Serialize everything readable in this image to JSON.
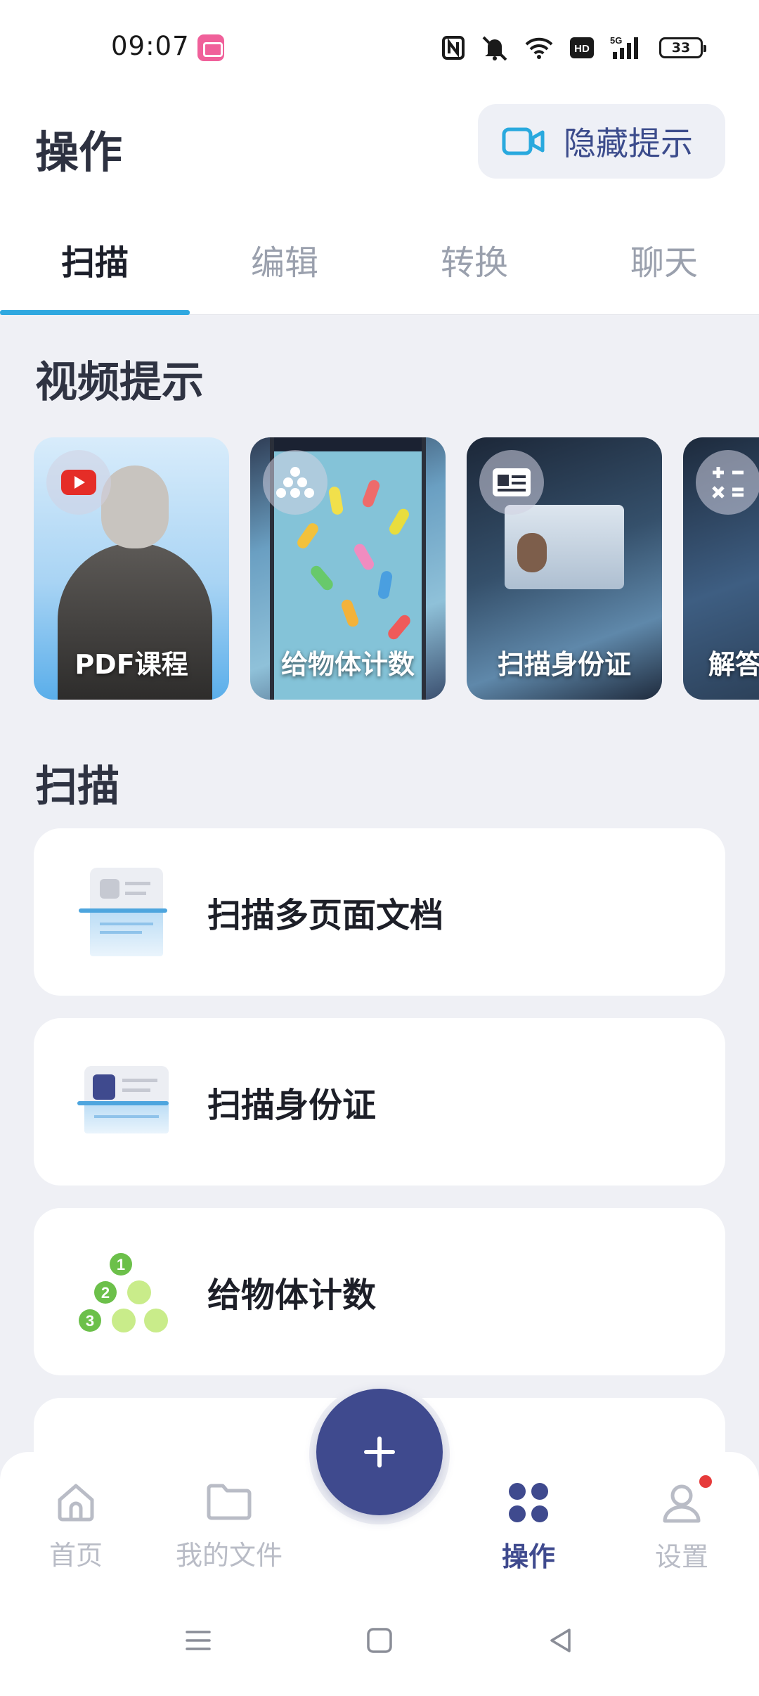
{
  "status_bar": {
    "time": "09:07",
    "battery": "33"
  },
  "header": {
    "title": "操作",
    "hide_tips_label": "隐藏提示",
    "hide_tips_icon": "video-camera-icon"
  },
  "tabs": [
    {
      "label": "扫描",
      "active": true
    },
    {
      "label": "编辑",
      "active": false
    },
    {
      "label": "转换",
      "active": false
    },
    {
      "label": "聊天",
      "active": false
    }
  ],
  "video_section": {
    "title": "视频提示",
    "items": [
      {
        "label": "PDF课程",
        "icon": "youtube-icon"
      },
      {
        "label": "给物体计数",
        "icon": "dots-pyramid-icon"
      },
      {
        "label": "扫描身份证",
        "icon": "id-card-icon"
      },
      {
        "label": "解答",
        "icon": "math-symbols-icon"
      }
    ]
  },
  "scan_section": {
    "title": "扫描",
    "items": [
      {
        "label": "扫描多页面文档",
        "icon": "multipage-document-scan-icon"
      },
      {
        "label": "扫描身份证",
        "icon": "id-card-scan-icon"
      },
      {
        "label": "给物体计数",
        "icon": "count-objects-icon"
      }
    ],
    "count_numbers": [
      "1",
      "2",
      "3"
    ]
  },
  "fab": {
    "icon": "plus-icon"
  },
  "bottom_nav": [
    {
      "label": "首页",
      "icon": "home-icon",
      "active": false
    },
    {
      "label": "我的文件",
      "icon": "folder-icon",
      "active": false
    },
    {
      "label": "操作",
      "icon": "four-dots-icon",
      "active": true
    },
    {
      "label": "设置",
      "icon": "user-icon",
      "active": false
    }
  ],
  "colors": {
    "accent": "#3f4a8e",
    "tab_indicator": "#2fa8e0",
    "notification_dot": "#e63a3a",
    "background": "#eff0f5"
  }
}
